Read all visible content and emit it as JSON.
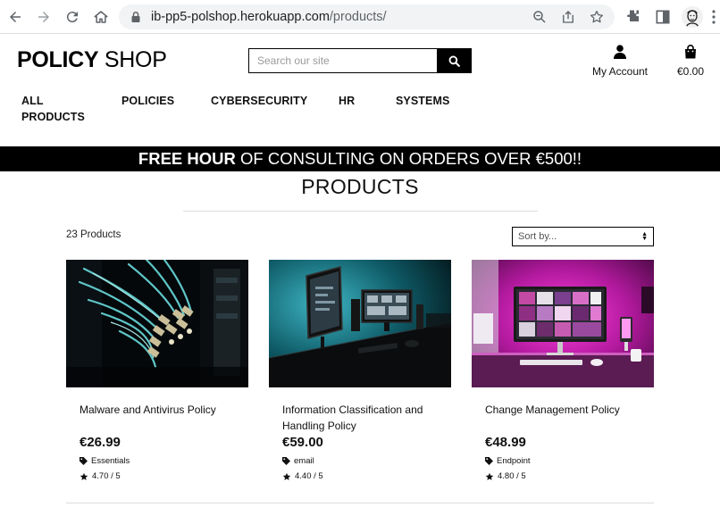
{
  "browser": {
    "url_host": "ib-pp5-polshop.herokuapp.com",
    "url_path": "/products/",
    "icons": [
      "back-icon",
      "forward-icon",
      "reload-icon",
      "home-icon",
      "lock-icon",
      "zoom-icon",
      "share-icon",
      "bookmark-star-icon",
      "extensions-icon",
      "side-panel-icon",
      "profile-avatar",
      "menu-icon"
    ]
  },
  "header": {
    "logo_bold": "POLICY",
    "logo_rest": " SHOP",
    "search_placeholder": "Search our site",
    "account_label": "My Account",
    "cart_total": "€0.00"
  },
  "nav": {
    "items": [
      {
        "label": "ALL PRODUCTS"
      },
      {
        "label": "POLICIES"
      },
      {
        "label": "CYBERSECURITY"
      },
      {
        "label": "HR"
      },
      {
        "label": "SYSTEMS"
      }
    ]
  },
  "banner": {
    "bold": "FREE HOUR",
    "rest": " OF CONSULTING ON ORDERS OVER €500!!"
  },
  "page": {
    "title": "PRODUCTS",
    "count": "23 Products",
    "sort_value": "Sort by..."
  },
  "products": [
    {
      "name": "Malware and Antivirus Policy",
      "price": "€26.99",
      "category": "Essentials",
      "rating": "4.70 / 5",
      "image": "network-cables-photo"
    },
    {
      "name": "Information Classification and Handling Policy",
      "price": "€59.00",
      "category": "email",
      "rating": "4.40 / 5",
      "image": "desk-monitors-photo"
    },
    {
      "name": "Change Management Policy",
      "price": "€48.99",
      "category": "Endpoint",
      "rating": "4.80 / 5",
      "image": "pink-desk-setup-photo"
    }
  ],
  "colors": {
    "banner_bg": "#000000",
    "text": "#111111",
    "omnibox_bg": "#f1f3f4"
  }
}
